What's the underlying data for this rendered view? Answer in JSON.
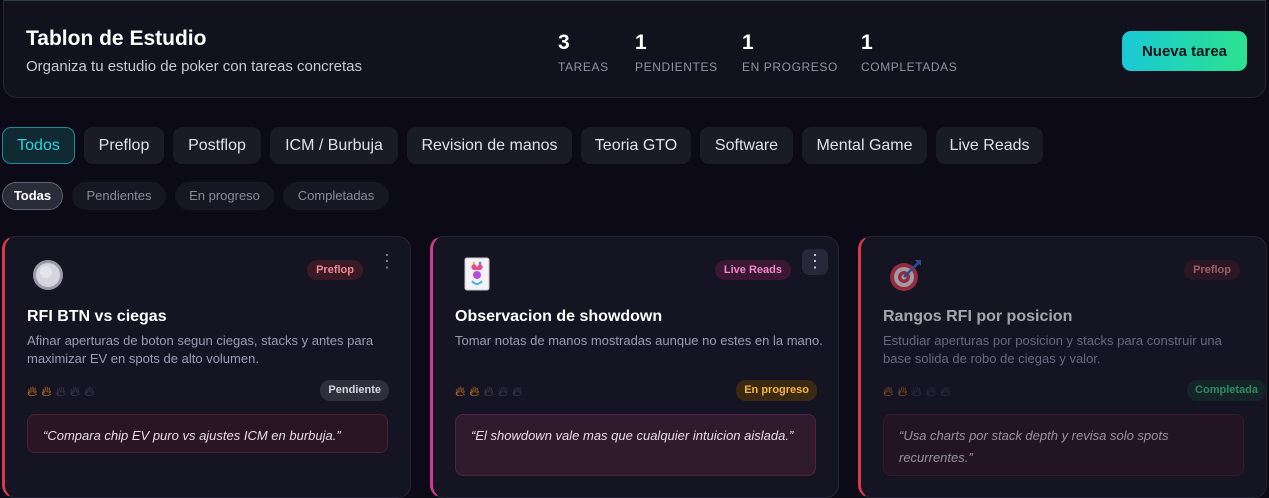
{
  "header": {
    "title": "Tablon de Estudio",
    "subtitle": "Organiza tu estudio de poker con tareas concretas",
    "stats": [
      {
        "value": "3",
        "label": "TAREAS"
      },
      {
        "value": "1",
        "label": "PENDIENTES"
      },
      {
        "value": "1",
        "label": "EN PROGRESO"
      },
      {
        "value": "1",
        "label": "COMPLETADAS"
      }
    ],
    "new_task_label": "Nueva tarea"
  },
  "categories": [
    {
      "label": "Todos",
      "active": true
    },
    {
      "label": "Preflop"
    },
    {
      "label": "Postflop"
    },
    {
      "label": "ICM / Burbuja"
    },
    {
      "label": "Revision de manos"
    },
    {
      "label": "Teoria GTO"
    },
    {
      "label": "Software"
    },
    {
      "label": "Mental Game"
    },
    {
      "label": "Live Reads"
    }
  ],
  "filters": [
    {
      "label": "Todas",
      "active": true
    },
    {
      "label": "Pendientes"
    },
    {
      "label": "En progreso"
    },
    {
      "label": "Completadas"
    }
  ],
  "cards": [
    {
      "icon": "poker-chip-icon",
      "category": "Preflop",
      "title": "RFI BTN vs ciegas",
      "description": "Afinar aperturas de boton segun ciegas, stacks y antes para maximizar EV en spots de alto volumen.",
      "priority": 2,
      "priority_max": 5,
      "status": "Pendiente",
      "note": "“Compara chip EV puro vs ajustes ICM en burbuja.”"
    },
    {
      "icon": "joker-card-icon",
      "category": "Live Reads",
      "title": "Observacion de showdown",
      "description": "Tomar notas de manos mostradas aunque no estes en la mano.",
      "priority": 2,
      "priority_max": 5,
      "status": "En progreso",
      "note": "“El showdown vale mas que cualquier intuicion aislada.”"
    },
    {
      "icon": "target-dart-icon",
      "category": "Preflop",
      "title": "Rangos RFI por posicion",
      "description": "Estudiar aperturas por posicion y stacks para construir una base solida de robo de ciegas y valor.",
      "priority": 2,
      "priority_max": 5,
      "status": "Completada",
      "note": "“Usa charts por stack depth y revisa solo spots recurrentes.”"
    }
  ],
  "colors": {
    "accent_cyan": "#1ac9d6",
    "accent_green": "#2be28c",
    "preflop": "#d63a48",
    "live_reads": "#d3388f",
    "pending": "#d4d6e0",
    "in_progress": "#f4b544",
    "completed": "#40d08f"
  }
}
